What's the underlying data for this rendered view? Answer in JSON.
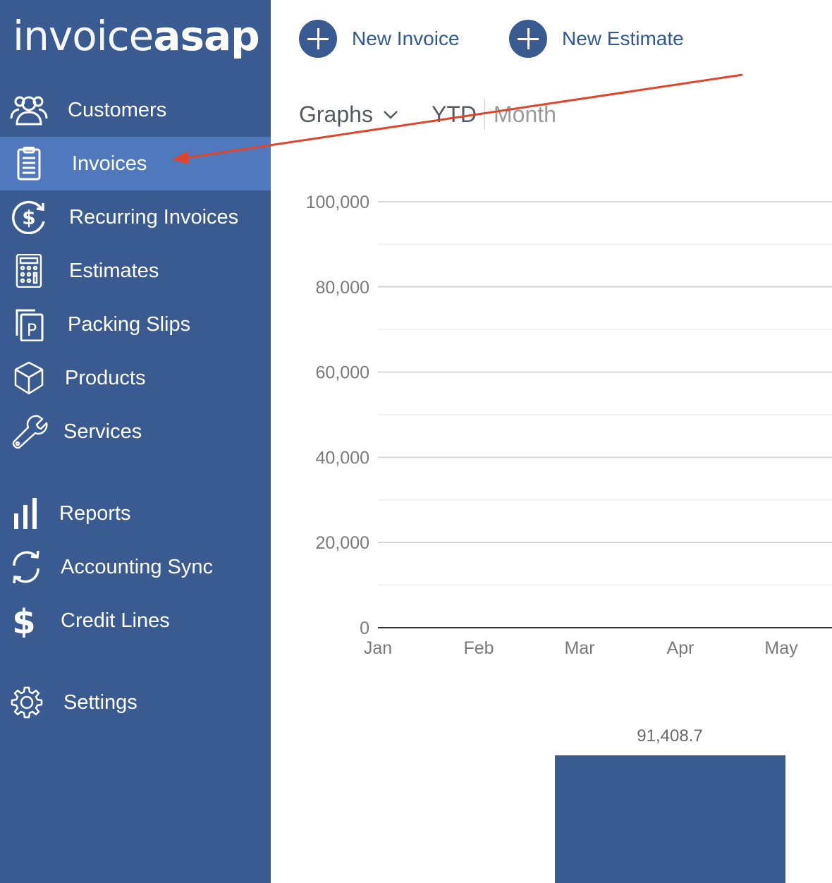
{
  "logo": {
    "part1": "invoice",
    "part2": "asap"
  },
  "sidebar": {
    "items": [
      {
        "label": "Customers",
        "icon": "customers-icon",
        "active": false
      },
      {
        "label": "Invoices",
        "icon": "clipboard-icon",
        "active": true
      },
      {
        "label": "Recurring Invoices",
        "icon": "recurring-dollar-icon",
        "active": false
      },
      {
        "label": "Estimates",
        "icon": "calculator-icon",
        "active": false
      },
      {
        "label": "Packing Slips",
        "icon": "packing-slip-icon",
        "active": false
      },
      {
        "label": "Products",
        "icon": "box-icon",
        "active": false
      },
      {
        "label": "Services",
        "icon": "wrench-icon",
        "active": false
      },
      {
        "label": "Reports",
        "icon": "bar-chart-icon",
        "active": false
      },
      {
        "label": "Accounting Sync",
        "icon": "sync-icon",
        "active": false
      },
      {
        "label": "Credit Lines",
        "icon": "dollar-icon",
        "active": false
      },
      {
        "label": "Settings",
        "icon": "gear-icon",
        "active": false
      }
    ]
  },
  "actions": {
    "new_invoice": "New Invoice",
    "new_estimate": "New Estimate"
  },
  "graphs": {
    "label": "Graphs",
    "ytd": "YTD",
    "month": "Month"
  },
  "colors": {
    "sidebar": "#3a5b92",
    "sidebar_active": "#5079bd",
    "accent": "#3a5b92",
    "annotation_arrow": "#e0442a"
  },
  "chart_data": {
    "type": "bar",
    "categories": [
      "Jan",
      "Feb",
      "Mar",
      "Apr",
      "May"
    ],
    "y_ticks": [
      "0",
      "20,000",
      "40,000",
      "60,000",
      "80,000",
      "100,000"
    ],
    "ylim": [
      0,
      100000
    ],
    "grid": true,
    "bar_values": [
      91408.7
    ],
    "bar_labels": [
      "91,408.7"
    ]
  }
}
